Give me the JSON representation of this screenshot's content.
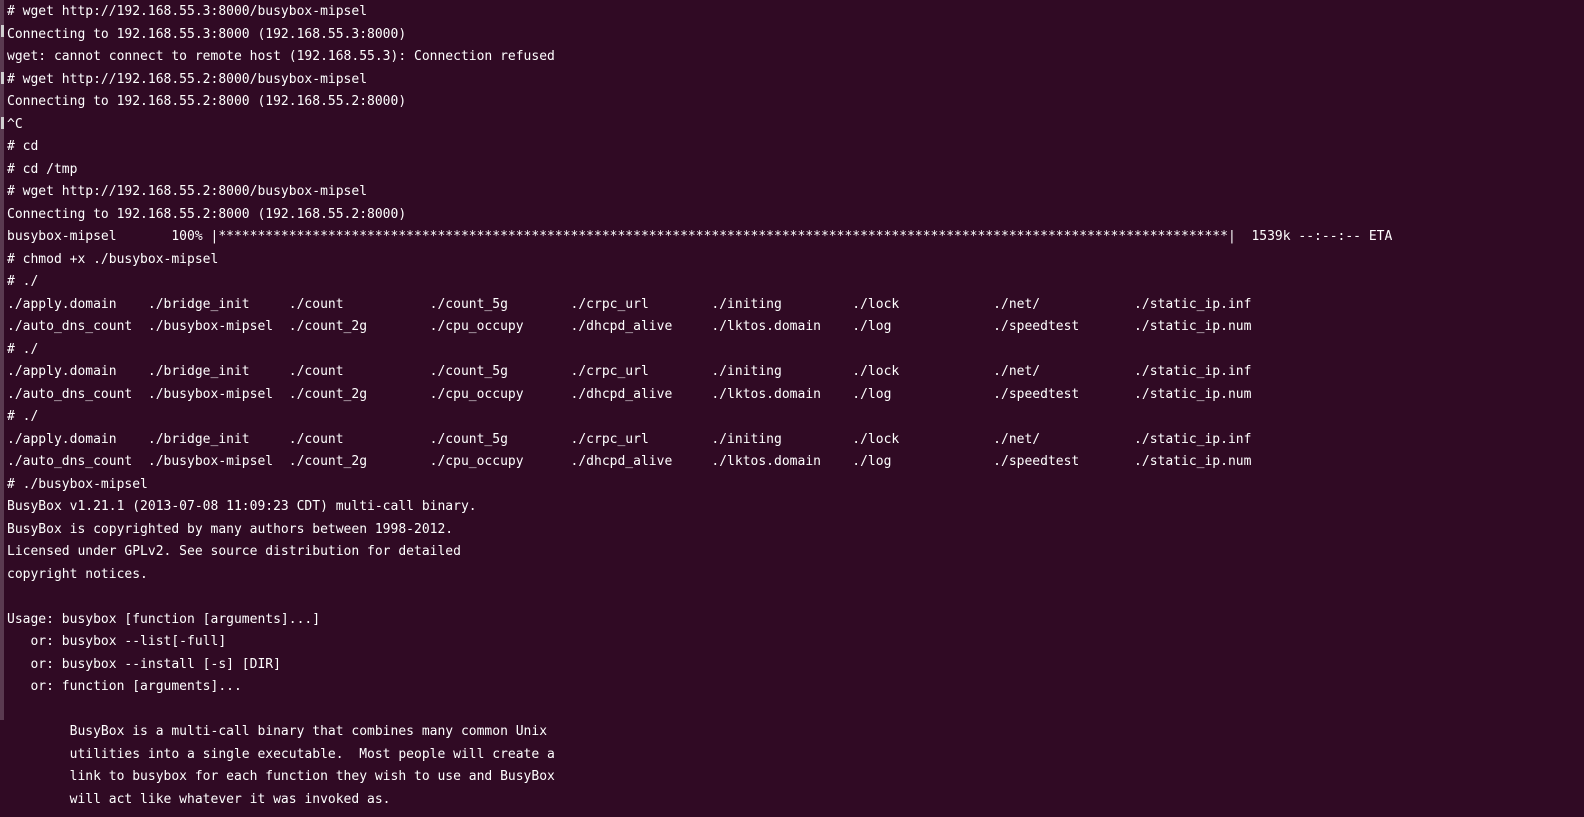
{
  "terminal": {
    "lines": [
      "# wget http://192.168.55.3:8000/busybox-mipsel",
      "Connecting to 192.168.55.3:8000 (192.168.55.3:8000)",
      "wget: cannot connect to remote host (192.168.55.3): Connection refused",
      "# wget http://192.168.55.2:8000/busybox-mipsel",
      "Connecting to 192.168.55.2:8000 (192.168.55.2:8000)",
      "^C",
      "# cd",
      "# cd /tmp",
      "# wget http://192.168.55.2:8000/busybox-mipsel",
      "Connecting to 192.168.55.2:8000 (192.168.55.2:8000)",
      "busybox-mipsel       100% |*********************************************************************************************************************************|  1539k --:--:-- ETA",
      "# chmod +x ./busybox-mipsel",
      "# ./",
      "./apply.domain    ./bridge_init     ./count           ./count_5g        ./crpc_url        ./initing         ./lock            ./net/            ./static_ip.inf",
      "./auto_dns_count  ./busybox-mipsel  ./count_2g        ./cpu_occupy      ./dhcpd_alive     ./lktos.domain    ./log             ./speedtest       ./static_ip.num",
      "# ./",
      "./apply.domain    ./bridge_init     ./count           ./count_5g        ./crpc_url        ./initing         ./lock            ./net/            ./static_ip.inf",
      "./auto_dns_count  ./busybox-mipsel  ./count_2g        ./cpu_occupy      ./dhcpd_alive     ./lktos.domain    ./log             ./speedtest       ./static_ip.num",
      "# ./",
      "./apply.domain    ./bridge_init     ./count           ./count_5g        ./crpc_url        ./initing         ./lock            ./net/            ./static_ip.inf",
      "./auto_dns_count  ./busybox-mipsel  ./count_2g        ./cpu_occupy      ./dhcpd_alive     ./lktos.domain    ./log             ./speedtest       ./static_ip.num",
      "# ./busybox-mipsel",
      "BusyBox v1.21.1 (2013-07-08 11:09:23 CDT) multi-call binary.",
      "BusyBox is copyrighted by many authors between 1998-2012.",
      "Licensed under GPLv2. See source distribution for detailed",
      "copyright notices.",
      "",
      "Usage: busybox [function [arguments]...]",
      "   or: busybox --list[-full]",
      "   or: busybox --install [-s] [DIR]",
      "   or: function [arguments]...",
      "",
      "        BusyBox is a multi-call binary that combines many common Unix",
      "        utilities into a single executable.  Most people will create a",
      "        link to busybox for each function they wish to use and BusyBox",
      "        will act like whatever it was invoked as."
    ]
  },
  "colors": {
    "background": "#300a24",
    "foreground": "#ffffff"
  }
}
